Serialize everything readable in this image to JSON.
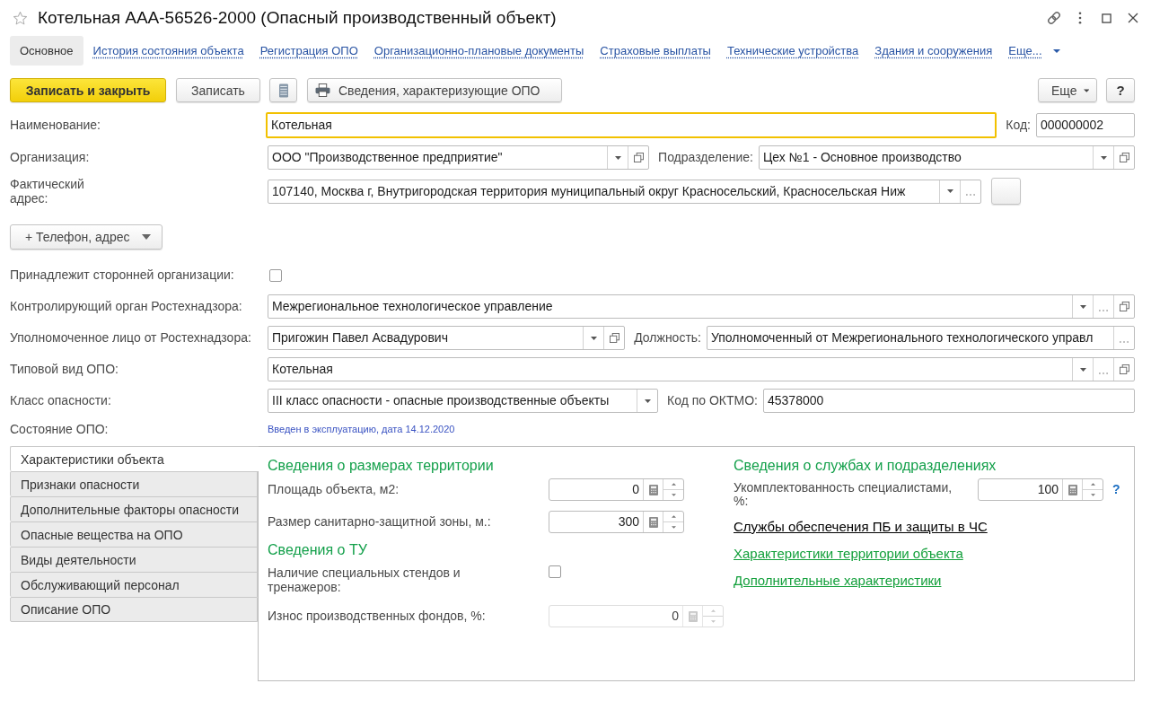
{
  "window": {
    "title": "Котельная ААА-56526-2000 (Опасный производственный объект)",
    "favorite": false
  },
  "nav": {
    "tabs": [
      {
        "label": "Основное",
        "selected": true
      },
      {
        "label": "История состояния объекта",
        "selected": false
      },
      {
        "label": "Регистрация ОПО",
        "selected": false
      },
      {
        "label": "Организационно-плановые документы",
        "selected": false
      },
      {
        "label": "Страховые выплаты",
        "selected": false
      },
      {
        "label": "Технические устройства",
        "selected": false
      },
      {
        "label": "Здания и сооружения",
        "selected": false
      }
    ],
    "more": "Еще..."
  },
  "toolbar": {
    "buttons": [
      {
        "kind": "primary",
        "label": "Записать и закрыть"
      },
      {
        "kind": "plain",
        "label": "Записать"
      },
      {
        "kind": "document"
      },
      {
        "kind": "print",
        "label": "Сведения, характеризующие ОПО"
      }
    ],
    "menu": "Еще",
    "help": "?"
  },
  "form": {
    "rows": [
      {
        "kind": "fields",
        "fields": [
          {
            "kind": "text",
            "label": "Наименование:",
            "value": "Котельная",
            "focused": true
          },
          {
            "kind": "text",
            "label": "Код:",
            "value": "000000002",
            "focused": false
          }
        ]
      },
      {
        "kind": "fields",
        "fields": [
          {
            "kind": "select",
            "label": "Организация:",
            "value": "ООО \"Производственное предприятие\"",
            "focused": false,
            "buttons": [
              {
                "kind": "dropdown"
              },
              {
                "kind": "open"
              }
            ]
          },
          {
            "kind": "select",
            "label": "Подразделение:",
            "value": "Цех №1 - Основное производство",
            "focused": false,
            "buttons": [
              {
                "kind": "dropdown"
              },
              {
                "kind": "open"
              }
            ]
          }
        ]
      },
      {
        "kind": "fields",
        "fields": [
          {
            "kind": "select",
            "label": "Фактический адрес:",
            "value": "107140, Москва г, Внутригородская территория муниципальный округ Красносельский, Красносельская Ниж",
            "focused": false,
            "buttons": [
              {
                "kind": "dropdown"
              },
              {
                "kind": "choose"
              },
              {
                "kind": "blank"
              }
            ]
          }
        ]
      },
      {
        "kind": "menu_button",
        "label": "+ Телефон, адрес"
      },
      {
        "kind": "fields",
        "fields": [
          {
            "kind": "checkbox",
            "label": "Принадлежит сторонней организации:",
            "checked": false
          }
        ]
      },
      {
        "kind": "fields",
        "fields": [
          {
            "kind": "select",
            "label": "Контролирующий орган Ростехнадзора:",
            "value": "Межрегиональное технологическое управление",
            "focused": false,
            "buttons": [
              {
                "kind": "dropdown"
              },
              {
                "kind": "choose"
              },
              {
                "kind": "open"
              }
            ]
          }
        ]
      },
      {
        "kind": "fields",
        "fields": [
          {
            "kind": "select",
            "label": "Уполномоченное лицо от Ростехнадзора:",
            "value": "Пригожин Павел Асвадурович",
            "focused": false,
            "buttons": [
              {
                "kind": "dropdown"
              },
              {
                "kind": "open"
              }
            ]
          },
          {
            "kind": "select",
            "label": "Должность:",
            "value": "Уполномоченный от Межрегионального технологического управл",
            "focused": false,
            "buttons": [
              {
                "kind": "choose"
              }
            ]
          }
        ]
      },
      {
        "kind": "fields",
        "fields": [
          {
            "kind": "select",
            "label": "Типовой вид ОПО:",
            "value": "Котельная",
            "focused": false,
            "buttons": [
              {
                "kind": "dropdown"
              },
              {
                "kind": "choose"
              },
              {
                "kind": "open"
              }
            ]
          }
        ]
      },
      {
        "kind": "fields",
        "fields": [
          {
            "kind": "select",
            "label": "Класс опасности:",
            "value": "III класс опасности - опасные производственные объекты",
            "focused": false,
            "buttons": [
              {
                "kind": "dropdown"
              }
            ]
          },
          {
            "kind": "text",
            "label": "Код по ОКТМО:",
            "value": "45378000",
            "focused": false
          }
        ]
      },
      {
        "kind": "fields",
        "fields": [
          {
            "kind": "status",
            "label": "Состояние ОПО:",
            "value": "Введен в эксплуатацию, дата 14.12.2020"
          }
        ]
      }
    ]
  },
  "details": {
    "tabs": [
      {
        "label": "Характеристики объекта",
        "selected": true
      },
      {
        "label": "Признаки опасности",
        "selected": false
      },
      {
        "label": "Дополнительные факторы опасности",
        "selected": false
      },
      {
        "label": "Опасные вещества на ОПО",
        "selected": false
      },
      {
        "label": "Виды деятельности",
        "selected": false
      },
      {
        "label": "Обслуживающий персонал",
        "selected": false
      },
      {
        "label": "Описание ОПО",
        "selected": false
      }
    ],
    "columns": [
      {
        "groups": [
          {
            "heading": "Сведения о размерах территории",
            "fields": [
              {
                "kind": "number",
                "label": "Площадь объекта, м2:",
                "value": "0",
                "disabled": false
              },
              {
                "kind": "number",
                "label": "Размер санитарно-защитной зоны, м.:",
                "value": "300",
                "disabled": false
              }
            ]
          },
          {
            "heading": "Сведения о ТУ",
            "fields": [
              {
                "kind": "checkbox",
                "label": "Наличие специальных стендов и тренажеров:",
                "checked": false
              },
              {
                "kind": "number",
                "label": "Износ производственных фондов, %:",
                "value": "0",
                "disabled": true
              }
            ]
          }
        ]
      },
      {
        "groups": [
          {
            "heading": "Сведения о службах и подразделениях",
            "fields": [
              {
                "kind": "number",
                "label": "Укомплектованность специалистами, %:",
                "value": "100",
                "disabled": false,
                "help": "?"
              },
              {
                "kind": "link",
                "label": "Службы обеспечения ПБ и защиты в ЧС",
                "color": "#000000"
              },
              {
                "kind": "link",
                "label": "Характеристики территории объекта",
                "color": "#14a03c"
              },
              {
                "kind": "link",
                "label": "Дополнительные характеристики",
                "color": "#14a03c"
              }
            ]
          }
        ]
      }
    ]
  }
}
